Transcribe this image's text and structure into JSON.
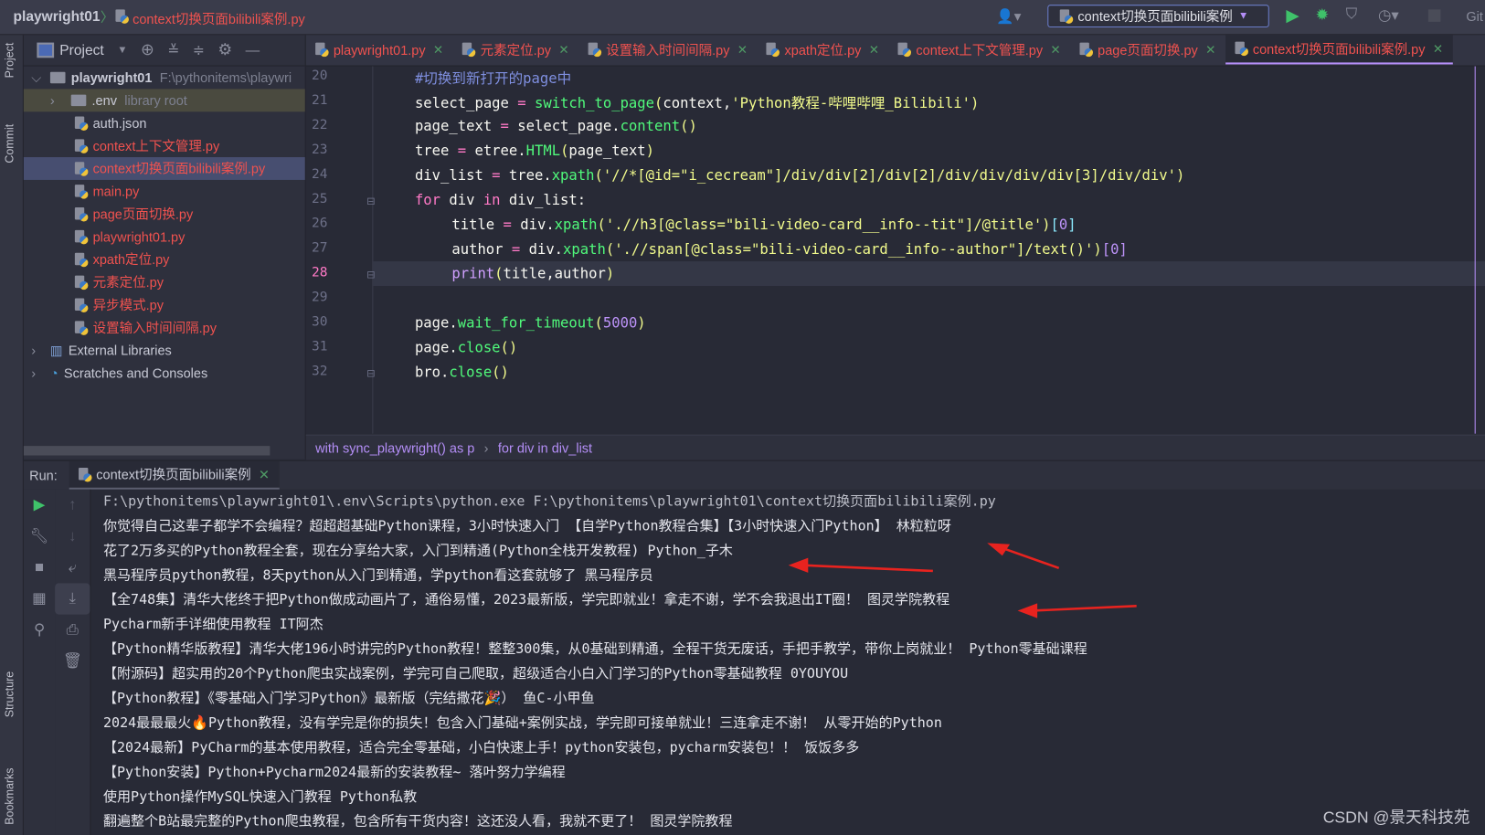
{
  "titlebar": {
    "project": "playwright01",
    "file": "context切换页面bilibili案例.py",
    "run_config": "context切换页面bilibili案例",
    "git": "Git"
  },
  "left_strip": {
    "project": "Project",
    "commit": "Commit",
    "structure": "Structure",
    "bookmarks": "Bookmarks"
  },
  "project_panel": {
    "title": "Project",
    "root": {
      "name": "playwright01",
      "path": "F:\\pythonitems\\playwri"
    },
    "env": {
      "name": ".env",
      "note": "library root"
    },
    "files": [
      {
        "name": "auth.json",
        "modified": false
      },
      {
        "name": "context上下文管理.py",
        "modified": true
      },
      {
        "name": "context切换页面bilibili案例.py",
        "modified": true,
        "selected": true
      },
      {
        "name": "main.py",
        "modified": true
      },
      {
        "name": "page页面切换.py",
        "modified": true
      },
      {
        "name": "playwright01.py",
        "modified": true
      },
      {
        "name": "xpath定位.py",
        "modified": true
      },
      {
        "name": "元素定位.py",
        "modified": true
      },
      {
        "name": "异步模式.py",
        "modified": true
      },
      {
        "name": "设置输入时间间隔.py",
        "modified": true
      }
    ],
    "external": "External Libraries",
    "scratches": "Scratches and Consoles"
  },
  "tabs": [
    {
      "label": "playwright01.py"
    },
    {
      "label": "元素定位.py"
    },
    {
      "label": "设置输入时间间隔.py"
    },
    {
      "label": "xpath定位.py"
    },
    {
      "label": "context上下文管理.py"
    },
    {
      "label": "page页面切换.py"
    },
    {
      "label": "context切换页面bilibili案例.py",
      "active": true
    }
  ],
  "editor": {
    "current_line": 28,
    "lines": [
      {
        "n": "20",
        "indent": 0,
        "tokens": [
          {
            "t": "#切换到新打开的page中",
            "c": "cm"
          }
        ]
      },
      {
        "n": "21",
        "indent": 0,
        "tokens": [
          {
            "t": "select_page ",
            "c": "pl"
          },
          {
            "t": "=",
            "c": "op"
          },
          {
            "t": " ",
            "c": "pl"
          },
          {
            "t": "switch_to_page",
            "c": "fn"
          },
          {
            "t": "(",
            "c": "br1"
          },
          {
            "t": "context,",
            "c": "pl"
          },
          {
            "t": "'Python教程-哔哩哔哩_Bilibili'",
            "c": "str"
          },
          {
            "t": ")",
            "c": "br1"
          }
        ]
      },
      {
        "n": "22",
        "indent": 0,
        "tokens": [
          {
            "t": "page_text ",
            "c": "pl"
          },
          {
            "t": "=",
            "c": "op"
          },
          {
            "t": " select_page.",
            "c": "pl"
          },
          {
            "t": "content",
            "c": "fn"
          },
          {
            "t": "()",
            "c": "br1"
          }
        ]
      },
      {
        "n": "23",
        "indent": 0,
        "tokens": [
          {
            "t": "tree ",
            "c": "pl"
          },
          {
            "t": "=",
            "c": "op"
          },
          {
            "t": " etree.",
            "c": "pl"
          },
          {
            "t": "HTML",
            "c": "fn"
          },
          {
            "t": "(",
            "c": "br1"
          },
          {
            "t": "page_text",
            "c": "pl"
          },
          {
            "t": ")",
            "c": "br1"
          }
        ]
      },
      {
        "n": "24",
        "indent": 0,
        "tokens": [
          {
            "t": "div_list ",
            "c": "pl"
          },
          {
            "t": "=",
            "c": "op"
          },
          {
            "t": " tree.",
            "c": "pl"
          },
          {
            "t": "xpath",
            "c": "fn"
          },
          {
            "t": "(",
            "c": "br1"
          },
          {
            "t": "'//*[@id=\"i_cecream\"]/div/div[2]/div[2]/div/div/div/div[3]/div/div'",
            "c": "str"
          },
          {
            "t": ")",
            "c": "br1"
          }
        ]
      },
      {
        "n": "25",
        "indent": 0,
        "tokens": [
          {
            "t": "for",
            "c": "kw"
          },
          {
            "t": " div ",
            "c": "pl"
          },
          {
            "t": "in",
            "c": "kw"
          },
          {
            "t": " div_list:",
            "c": "pl"
          }
        ]
      },
      {
        "n": "26",
        "indent": 1,
        "tokens": [
          {
            "t": "title ",
            "c": "pl"
          },
          {
            "t": "=",
            "c": "op"
          },
          {
            "t": " div.",
            "c": "pl"
          },
          {
            "t": "xpath",
            "c": "fn"
          },
          {
            "t": "(",
            "c": "br1"
          },
          {
            "t": "'.//h3[@class=\"bili-video-card__info--tit\"]/@title'",
            "c": "str"
          },
          {
            "t": ")",
            "c": "br1"
          },
          {
            "t": "[",
            "c": "br2"
          },
          {
            "t": "0",
            "c": "num"
          },
          {
            "t": "]",
            "c": "br2"
          }
        ]
      },
      {
        "n": "27",
        "indent": 1,
        "tokens": [
          {
            "t": "author ",
            "c": "pl"
          },
          {
            "t": "=",
            "c": "op"
          },
          {
            "t": " div.",
            "c": "pl"
          },
          {
            "t": "xpath",
            "c": "fn"
          },
          {
            "t": "(",
            "c": "br1"
          },
          {
            "t": "'.//span[@class=\"bili-video-card__info--author\"]/text()'",
            "c": "str"
          },
          {
            "t": ")",
            "c": "br1"
          },
          {
            "t": "[",
            "c": "br3"
          },
          {
            "t": "0",
            "c": "num"
          },
          {
            "t": "]",
            "c": "br3"
          }
        ]
      },
      {
        "n": "28",
        "indent": 1,
        "tokens": [
          {
            "t": "print",
            "c": "pr"
          },
          {
            "t": "(",
            "c": "br1"
          },
          {
            "t": "title,author",
            "c": "pl"
          },
          {
            "t": ")",
            "c": "br1"
          }
        ]
      },
      {
        "n": "29",
        "indent": 0,
        "tokens": []
      },
      {
        "n": "30",
        "indent": 0,
        "tokens": [
          {
            "t": "page.",
            "c": "pl"
          },
          {
            "t": "wait_for_timeout",
            "c": "fn"
          },
          {
            "t": "(",
            "c": "br1"
          },
          {
            "t": "5000",
            "c": "num"
          },
          {
            "t": ")",
            "c": "br1"
          }
        ]
      },
      {
        "n": "31",
        "indent": 0,
        "tokens": [
          {
            "t": "page.",
            "c": "pl"
          },
          {
            "t": "close",
            "c": "fn"
          },
          {
            "t": "()",
            "c": "br1"
          }
        ]
      },
      {
        "n": "32",
        "indent": 0,
        "tokens": [
          {
            "t": "bro.",
            "c": "pl"
          },
          {
            "t": "close",
            "c": "fn"
          },
          {
            "t": "()",
            "c": "br1"
          }
        ]
      }
    ]
  },
  "breadcrumbs": [
    "with sync_playwright() as p",
    "for div in div_list"
  ],
  "run": {
    "label": "Run:",
    "tab": "context切换页面bilibili案例",
    "output": [
      "F:\\pythonitems\\playwright01\\.env\\Scripts\\python.exe F:\\pythonitems\\playwright01\\context切换页面bilibili案例.py",
      "你觉得自己这辈子都学不会编程？超超超基础Python课程，3小时快速入门 【自学Python教程合集】【3小时快速入门Python】 林粒粒呀",
      "花了2万多买的Python教程全套，现在分享给大家，入门到精通(Python全栈开发教程) Python_子木",
      "黑马程序员python教程，8天python从入门到精通，学python看这套就够了 黑马程序员",
      "【全748集】清华大佬终于把Python做成动画片了，通俗易懂，2023最新版，学完即就业！拿走不谢，学不会我退出IT圈！ 图灵学院教程",
      "Pycharm新手详细使用教程 IT阿杰",
      "【Python精华版教程】清华大佬196小时讲完的Python教程！整整300集，从0基础到精通，全程干货无废话，手把手教学，带你上岗就业！ Python零基础课程",
      "【附源码】超实用的20个Python爬虫实战案例，学完可自己爬取，超级适合小白入门学习的Python零基础教程 0YOUYOU",
      "【Python教程】《零基础入门学习Python》最新版（完结撒花🎉） 鱼C-小甲鱼",
      "2024最最最火🔥Python教程，没有学完是你的损失！包含入门基础+案例实战，学完即可接单就业！三连拿走不谢！ 从零开始的Python",
      "【2024最新】PyCharm的基本使用教程，适合完全零基础，小白快速上手！python安装包，pycharm安装包！！ 饭饭多多",
      "【Python安装】Python+Pycharm2024最新的安装教程~ 落叶努力学编程",
      "使用Python操作MySQL快速入门教程 Python私教",
      "翻遍整个B站最完整的Python爬虫教程，包含所有干货内容！这还没人看，我就不更了！ 图灵学院教程"
    ]
  },
  "watermark": "CSDN @景天科技苑",
  "colors": {
    "accent": "#b48ef7",
    "modified_file": "#f0524f",
    "annotation_arrow": "#e8231f"
  }
}
